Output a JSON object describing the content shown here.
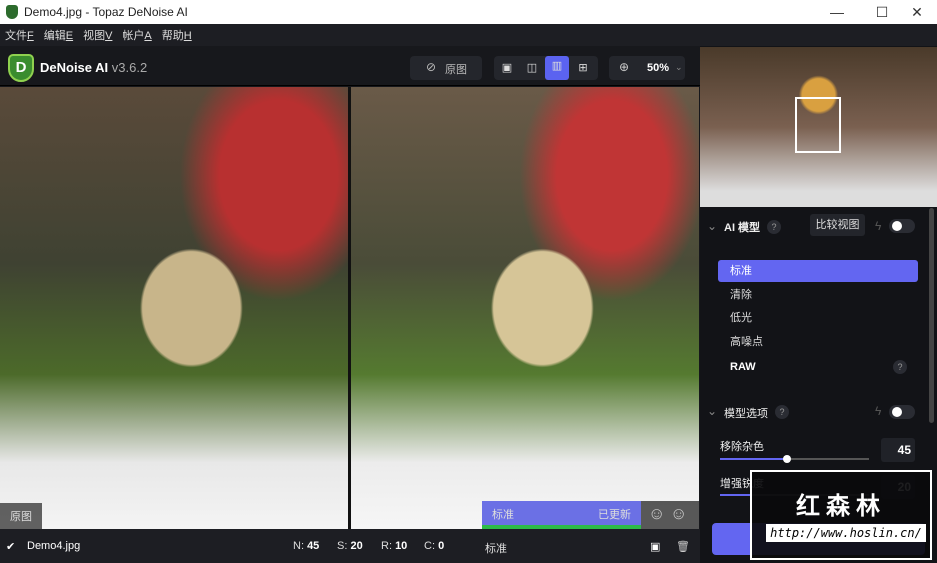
{
  "window": {
    "title": "Demo4.jpg - Topaz DeNoise AI",
    "minimize": "—",
    "maximize": "☐",
    "close": "✕"
  },
  "menu": [
    {
      "label": "文件",
      "key": "F"
    },
    {
      "label": "编辑",
      "key": "E"
    },
    {
      "label": "视图",
      "key": "V"
    },
    {
      "label": "帐户",
      "key": "A"
    },
    {
      "label": "帮助",
      "key": "H"
    }
  ],
  "app": {
    "logo": "D",
    "name": "DeNoise AI",
    "version": "v3.6.2"
  },
  "toolbar": {
    "original_label": "原图",
    "zoom": "50%"
  },
  "preview": {
    "left_tag": "原图",
    "right_model": "标准",
    "right_status": "已更新"
  },
  "panel": {
    "ai_model": {
      "title": "AI 模型",
      "compare": "比较视图",
      "models": [
        "标准",
        "清除",
        "低光",
        "高噪点",
        "RAW"
      ],
      "selected": 0
    },
    "options": {
      "title": "模型选项",
      "sliders": [
        {
          "label": "移除杂色",
          "value": 45
        },
        {
          "label": "增强锐度",
          "value": 20
        }
      ]
    }
  },
  "status": {
    "file": "Demo4.jpg",
    "n_label": "N:",
    "n": "45",
    "s_label": "S:",
    "s": "20",
    "r_label": "R:",
    "r": "10",
    "c_label": "C:",
    "c": "0",
    "model": "标准"
  },
  "watermark": {
    "title": "红森林",
    "url": "http://www.hoslin.cn/"
  }
}
